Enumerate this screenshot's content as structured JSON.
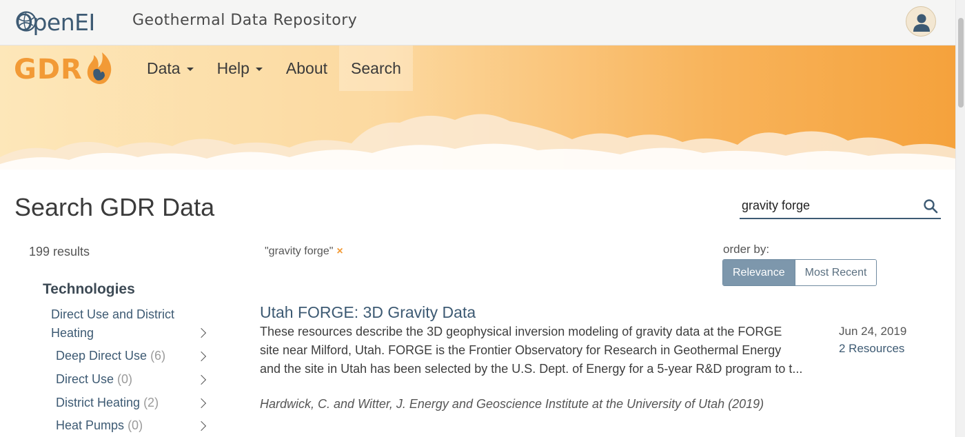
{
  "header": {
    "openei_logo": "OpenEI",
    "site_name": "Geothermal Data Repository"
  },
  "nav": {
    "logo": "GDR",
    "items": [
      {
        "label": "Data",
        "dropdown": true
      },
      {
        "label": "Help",
        "dropdown": true
      },
      {
        "label": "About",
        "dropdown": false
      },
      {
        "label": "Search",
        "dropdown": false
      }
    ]
  },
  "search": {
    "page_title": "Search GDR Data",
    "query": "gravity forge",
    "results_count": "199 results",
    "active_filter": "\"gravity forge\"",
    "remove_filter": "×"
  },
  "order": {
    "label": "order by:",
    "options": [
      "Relevance",
      "Most Recent"
    ],
    "selected": "Relevance"
  },
  "facets": {
    "title": "Technologies",
    "items": [
      {
        "label": "Direct Use and District Heating",
        "count": ""
      },
      {
        "label": "Deep Direct Use",
        "count": "(6)"
      },
      {
        "label": "Direct Use",
        "count": "(0)"
      },
      {
        "label": "District Heating",
        "count": "(2)"
      },
      {
        "label": "Heat Pumps",
        "count": "(0)"
      }
    ]
  },
  "results": [
    {
      "title": "Utah FORGE: 3D Gravity Data",
      "description": "These resources describe the 3D geophysical inversion modeling of gravity data at the FORGE site near Milford, Utah. FORGE is the Frontier Observatory for Research in Geothermal Energy and the site in Utah has been selected by the U.S. Dept. of Energy for a 5-year R&D program to t...",
      "citation": "Hardwick, C. and Witter, J. Energy and Geoscience Institute at the University of Utah (2019)",
      "date": "Jun 24, 2019",
      "resources": "2 Resources"
    }
  ],
  "colors": {
    "accent_orange": "#f29a36",
    "link_blue": "#3d5a73",
    "selected_button": "#7d97ac"
  }
}
